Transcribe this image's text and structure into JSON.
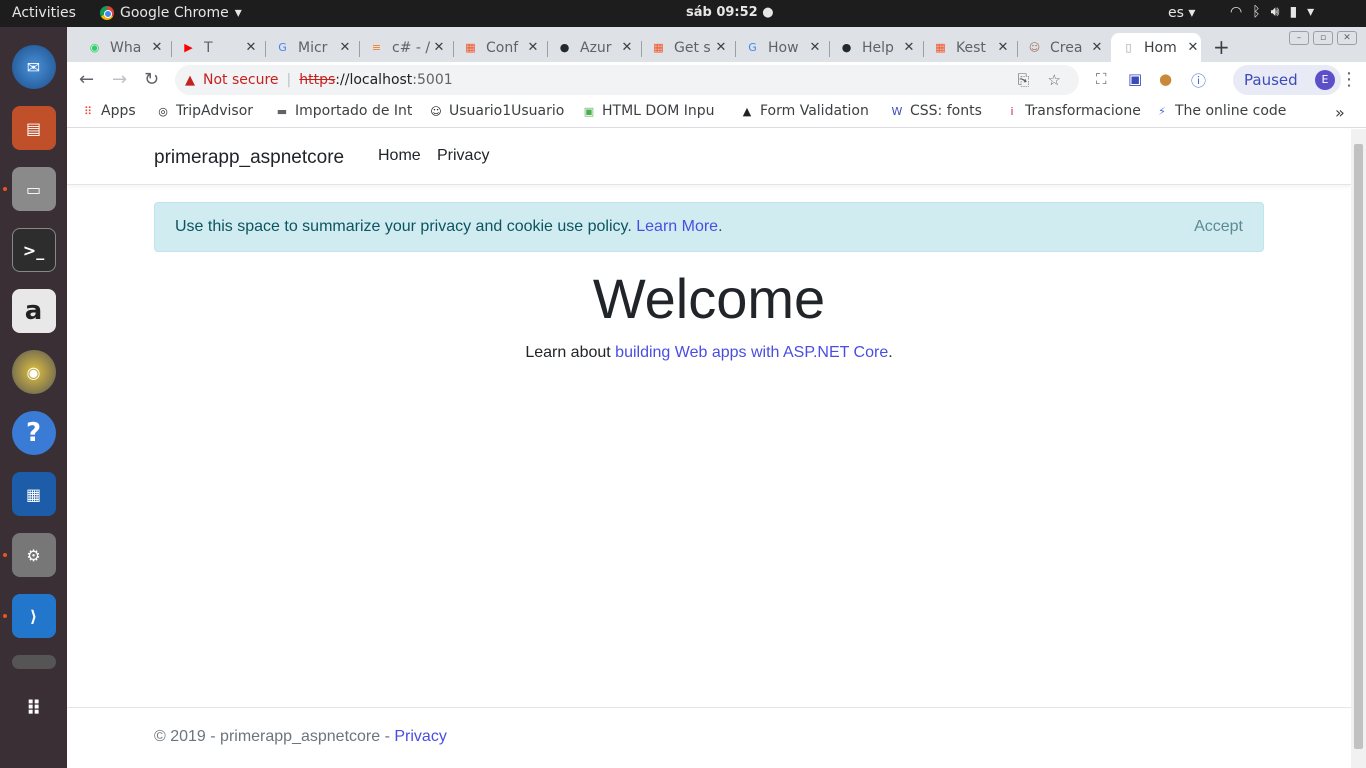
{
  "topbar": {
    "activities": "Activities",
    "app_name": "Google Chrome",
    "clock": "sáb 09:52",
    "lang": "es"
  },
  "tabs": [
    {
      "title": "Wha",
      "icon": "whatsapp-icon",
      "color": "#25d366"
    },
    {
      "title": "T",
      "icon": "youtube-icon",
      "color": "#ff0000"
    },
    {
      "title": "Micr",
      "icon": "google-icon",
      "color": "#4285f4"
    },
    {
      "title": "c# - /",
      "icon": "stackoverflow-icon",
      "color": "#f48024"
    },
    {
      "title": "Conf",
      "icon": "microsoft-icon",
      "color": "#f25022"
    },
    {
      "title": "Azur",
      "icon": "github-icon",
      "color": "#24292e"
    },
    {
      "title": "Get s",
      "icon": "microsoft-icon",
      "color": "#f25022"
    },
    {
      "title": "How",
      "icon": "google-icon",
      "color": "#4285f4"
    },
    {
      "title": "Help",
      "icon": "github-icon",
      "color": "#24292e"
    },
    {
      "title": "Kest",
      "icon": "microsoft-icon",
      "color": "#f25022"
    },
    {
      "title": "Crea",
      "icon": "avatar-icon",
      "color": "#a07060"
    },
    {
      "title": "Hom",
      "icon": "page-icon",
      "color": "#9aa0a6"
    }
  ],
  "omnibox": {
    "not_secure": "Not secure",
    "scheme": "https",
    "separator": "://",
    "host": "localhost",
    "port": ":5001"
  },
  "profile": {
    "status": "Paused",
    "initial": "E"
  },
  "bookmarks": [
    {
      "label": "Apps",
      "icon": "apps-grid-icon"
    },
    {
      "label": "TripAdvisor",
      "icon": "tripadvisor-icon"
    },
    {
      "label": "Importado de Int",
      "icon": "folder-icon"
    },
    {
      "label": "Usuario1Usuario",
      "icon": "smiley-icon"
    },
    {
      "label": "HTML DOM Inpu",
      "icon": "w3-green-icon"
    },
    {
      "label": "Form Validation",
      "icon": "linux-icon"
    },
    {
      "label": "CSS: fonts",
      "icon": "w3schools-icon"
    },
    {
      "label": "Transformacione",
      "icon": "info-icon"
    },
    {
      "label": "The online code",
      "icon": "bolt-icon"
    }
  ],
  "page": {
    "brand": "primerapp_aspnetcore",
    "nav_home": "Home",
    "nav_privacy": "Privacy",
    "cookie_msg": "Use this space to summarize your privacy and cookie use policy.",
    "cookie_link": "Learn More",
    "cookie_period": ".",
    "accept": "Accept",
    "heading": "Welcome",
    "learn_prefix": "Learn about ",
    "learn_link": "building Web apps with ASP.NET Core",
    "learn_suffix": ".",
    "footer_text": "© 2019 - primerapp_aspnetcore - ",
    "footer_link": "Privacy"
  }
}
